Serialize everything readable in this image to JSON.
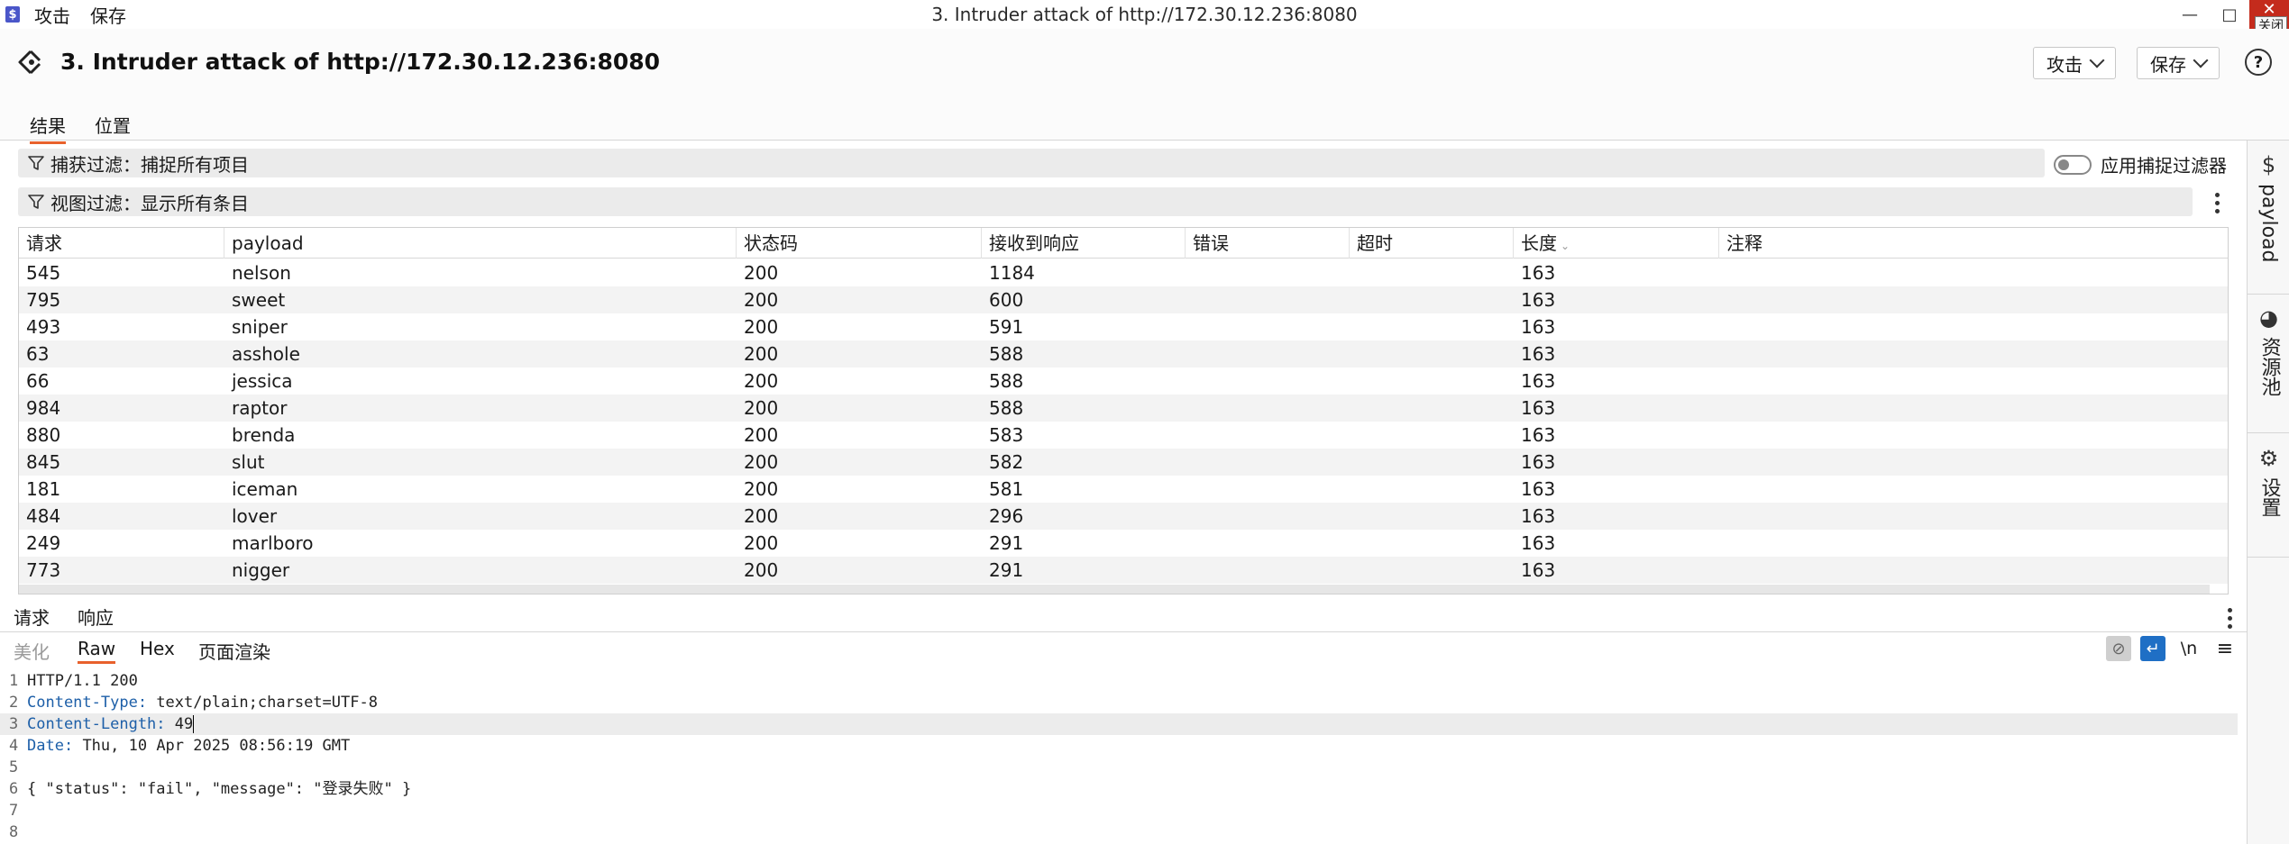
{
  "os": {
    "menu": [
      "攻击",
      "保存"
    ],
    "title": "3. Intruder attack of http://172.30.12.236:8080",
    "tooltip": "关闭"
  },
  "header": {
    "title": "3. Intruder attack of http://172.30.12.236:8080",
    "attack_label": "攻击",
    "save_label": "保存"
  },
  "tabs": [
    {
      "label": "结果",
      "active": true
    },
    {
      "label": "位置",
      "active": false
    }
  ],
  "filters": {
    "capture": "捕获过滤：捕捉所有项目",
    "view": "视图过滤：显示所有条目",
    "apply_toggle_label": "应用捕捉过滤器"
  },
  "table": {
    "columns": [
      "请求",
      "payload",
      "状态码",
      "接收到响应",
      "错误",
      "超时",
      "长度",
      "注释"
    ],
    "rows": [
      [
        "545",
        "nelson",
        "200",
        "1184",
        "",
        "",
        "163",
        ""
      ],
      [
        "795",
        "sweet",
        "200",
        "600",
        "",
        "",
        "163",
        ""
      ],
      [
        "493",
        "sniper",
        "200",
        "591",
        "",
        "",
        "163",
        ""
      ],
      [
        "63",
        "asshole",
        "200",
        "588",
        "",
        "",
        "163",
        ""
      ],
      [
        "66",
        "jessica",
        "200",
        "588",
        "",
        "",
        "163",
        ""
      ],
      [
        "984",
        "raptor",
        "200",
        "588",
        "",
        "",
        "163",
        ""
      ],
      [
        "880",
        "brenda",
        "200",
        "583",
        "",
        "",
        "163",
        ""
      ],
      [
        "845",
        "slut",
        "200",
        "582",
        "",
        "",
        "163",
        ""
      ],
      [
        "181",
        "iceman",
        "200",
        "581",
        "",
        "",
        "163",
        ""
      ],
      [
        "484",
        "lover",
        "200",
        "296",
        "",
        "",
        "163",
        ""
      ],
      [
        "249",
        "marlboro",
        "200",
        "291",
        "",
        "",
        "163",
        ""
      ],
      [
        "773",
        "nigger",
        "200",
        "291",
        "",
        "",
        "163",
        ""
      ]
    ]
  },
  "lower": {
    "tabs": [
      {
        "label": "请求",
        "active": false
      },
      {
        "label": "响应",
        "active": true
      }
    ],
    "view_tabs": [
      {
        "label": "美化",
        "state": "disabled"
      },
      {
        "label": "Raw",
        "state": "active"
      },
      {
        "label": "Hex",
        "state": "normal"
      },
      {
        "label": "页面渲染",
        "state": "normal"
      }
    ],
    "newline_label": "\\n",
    "lines": [
      {
        "n": "1",
        "name": "",
        "value": "HTTP/1.1 200"
      },
      {
        "n": "2",
        "name": "Content-Type",
        "value": " text/plain;charset=UTF-8"
      },
      {
        "n": "3",
        "name": "Content-Length",
        "value": " 49"
      },
      {
        "n": "4",
        "name": "Date",
        "value": " Thu, 10 Apr 2025 08:56:19 GMT"
      },
      {
        "n": "5",
        "name": "",
        "value": ""
      },
      {
        "n": "6",
        "name": "",
        "value": "{ \"status\": \"fail\", \"message\": \"登录失败\" }"
      },
      {
        "n": "7",
        "name": "",
        "value": ""
      },
      {
        "n": "8",
        "name": "",
        "value": ""
      }
    ]
  },
  "sidebar": {
    "items": [
      "payload",
      "资源池",
      "设置"
    ]
  },
  "colors": {
    "accent": "#e8612c",
    "header_name": "#1d5fa8",
    "wrap_button": "#1f6fc5"
  }
}
